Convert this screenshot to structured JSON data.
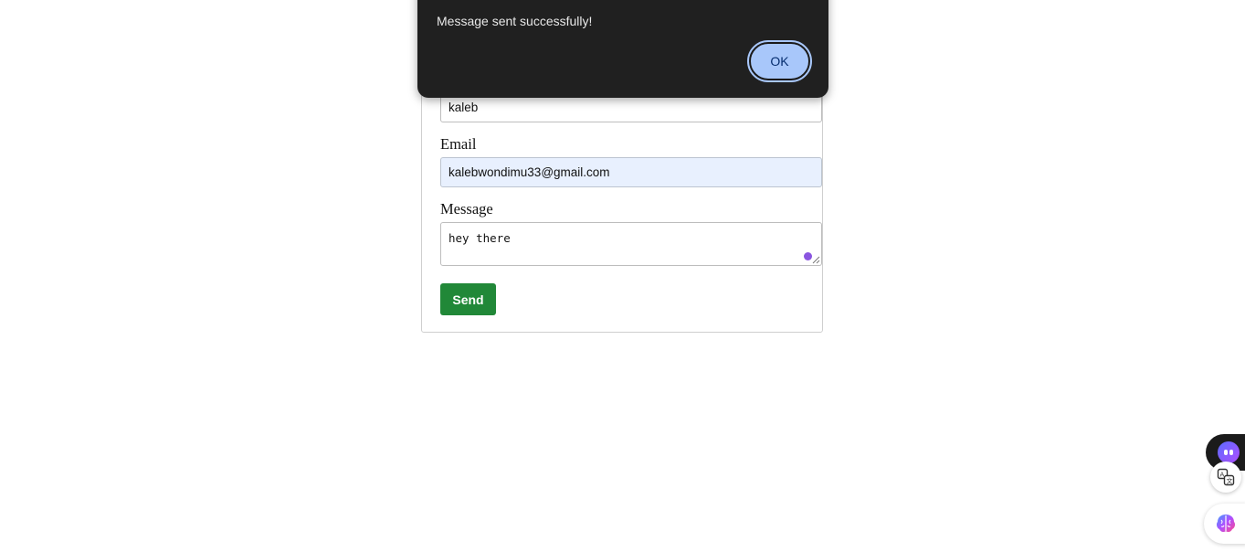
{
  "form": {
    "name_value": "kaleb",
    "email_label": "Email",
    "email_value": "kalebwondimu33@gmail.com",
    "message_label": "Message",
    "message_value": "hey there",
    "send_label": "Send",
    "send_color": "#218838"
  },
  "dialog": {
    "message": "Message sent successfully!",
    "ok_label": "OK",
    "ok_color": "#a8c7fa"
  },
  "widgets": {
    "assistant_icon": "bot-face-icon",
    "translate_icon": "translate-icon",
    "brain_icon": "brain-icon"
  }
}
